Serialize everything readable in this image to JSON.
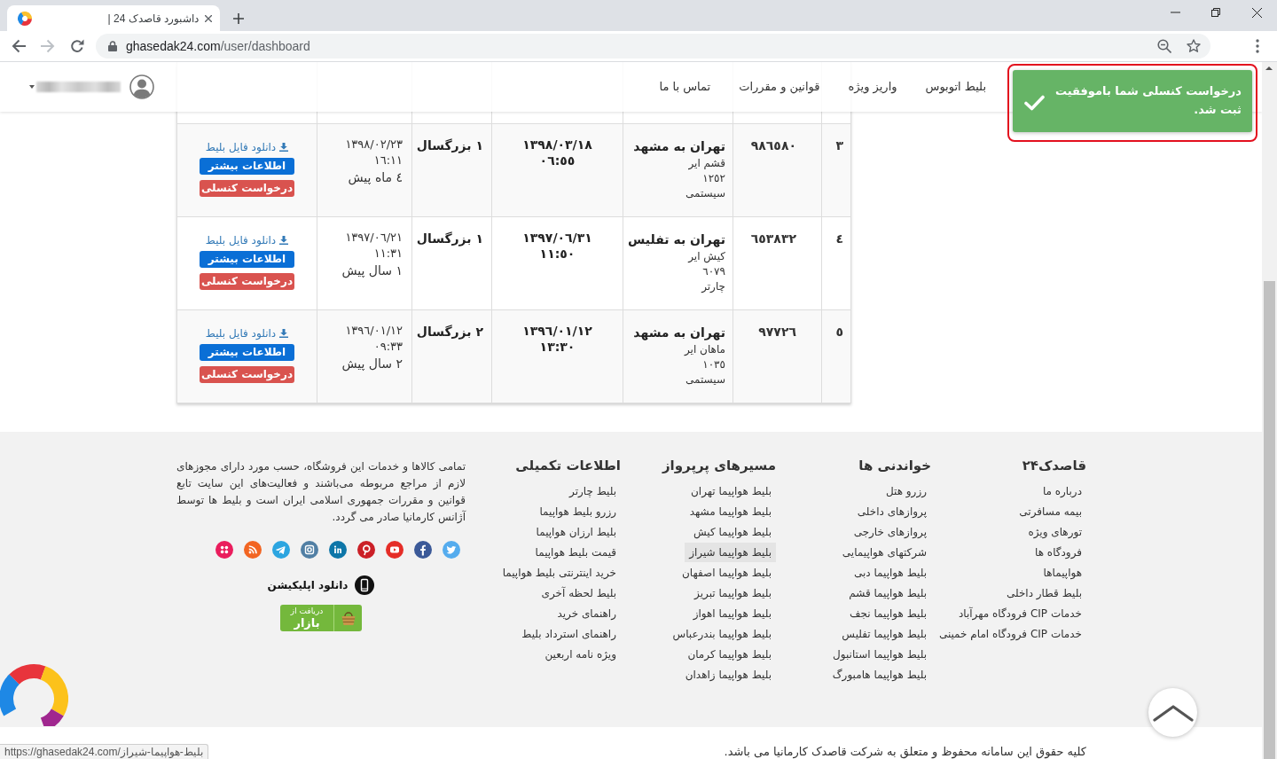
{
  "browser": {
    "tab": {
      "title": "داشبورد قاصدک 24 |"
    },
    "address": {
      "host": "ghasedak24.com",
      "path": "/user/dashboard"
    },
    "status_url": "https://ghasedak24.com/بلیط-هواپیما-شیراز"
  },
  "header": {
    "nav": [
      "بلیط اتوبوس",
      "واریز ویژه",
      "قوانین و مقررات",
      "تماس با ما"
    ]
  },
  "toast": {
    "message": "درخواست کنسلی شما باموفقیت ثبت شد.",
    "annotated": true
  },
  "table": {
    "rows": [
      {
        "kind": "clipped"
      },
      {
        "kind": "full",
        "number": "٣",
        "code": "٩٨٦٥٨٠",
        "route": {
          "title": "تهران به مشهد",
          "airline": "قشم ایر",
          "flight": "١٢٥٢",
          "type": "سیستمی"
        },
        "flight_date": {
          "date": "١٣٩٨/٠٣/١٨",
          "time": "٠٦:٥٥"
        },
        "passengers": "١ بزرگسال",
        "purchase": {
          "date": "١٣٩٨/٠٢/٢٣",
          "time": "١٦:١١",
          "ago": "٤ ماه پیش"
        },
        "actions": {
          "download": "دانلود فایل بلیط",
          "info": "اطلاعات بیشتر",
          "cancel": "درخواست کنسلی"
        }
      },
      {
        "kind": "full",
        "number": "٤",
        "code": "٦٥٣٨٣٢",
        "route": {
          "title": "تهران به تفلیس",
          "airline": "کیش ایر",
          "flight": "٦٠٧٩",
          "type": "چارتر"
        },
        "flight_date": {
          "date": "١٣٩٧/٠٦/٣١",
          "time": "١١:٥٠"
        },
        "passengers": "١ بزرگسال",
        "purchase": {
          "date": "١٣٩٧/٠٦/٢١",
          "time": "١١:٣١",
          "ago": "١ سال پیش"
        },
        "actions": {
          "download": "دانلود فایل بلیط",
          "info": "اطلاعات بیشتر",
          "cancel": "درخواست کنسلی"
        }
      },
      {
        "kind": "full",
        "number": "٥",
        "code": "٩٧٧٢٦",
        "route": {
          "title": "تهران به مشهد",
          "airline": "ماهان ایر",
          "flight": "١٠٣٥",
          "type": "سیستمی"
        },
        "flight_date": {
          "date": "١٣٩٦/٠١/١٢",
          "time": "١٣:٣٠"
        },
        "passengers": "٢ بزرگسال",
        "purchase": {
          "date": "١٣٩٦/٠١/١٢",
          "time": "٠٩:٣٣",
          "ago": "٢ سال پیش"
        },
        "actions": {
          "download": "دانلود فایل بلیط",
          "info": "اطلاعات بیشتر",
          "cancel": "درخواست کنسلی"
        }
      }
    ]
  },
  "footer": {
    "columns": [
      {
        "title": "قاصدک۲۴",
        "links": [
          {
            "label": "درباره ما",
            "highlighted": false
          },
          {
            "label": "بیمه مسافرتی",
            "highlighted": false
          },
          {
            "label": "تورهای ویژه",
            "highlighted": false
          },
          {
            "label": "فرودگاه ها",
            "highlighted": false
          },
          {
            "label": "هواپیماها",
            "highlighted": false
          },
          {
            "label": "بلیط قطار داخلی",
            "highlighted": false
          },
          {
            "label": "خدمات CIP فرودگاه مهرآباد",
            "highlighted": false
          },
          {
            "label": "خدمات CIP فرودگاه امام خمینی",
            "highlighted": false
          }
        ]
      },
      {
        "title": "خواندنی ها",
        "links": [
          {
            "label": "رزرو هتل",
            "highlighted": false
          },
          {
            "label": "پروازهای داخلی",
            "highlighted": false
          },
          {
            "label": "پروازهای خارجی",
            "highlighted": false
          },
          {
            "label": "شرکتهای هواپیمایی",
            "highlighted": false
          },
          {
            "label": "بلیط هواپیما دبی",
            "highlighted": false
          },
          {
            "label": "بلیط هواپیما قشم",
            "highlighted": false
          },
          {
            "label": "بلیط هواپیما نجف",
            "highlighted": false
          },
          {
            "label": "بلیط هواپیما تفلیس",
            "highlighted": false
          },
          {
            "label": "بلیط هواپیما استانبول",
            "highlighted": false
          },
          {
            "label": "بلیط هواپیما هامبورگ",
            "highlighted": false
          }
        ]
      },
      {
        "title": "مسیرهای پرپرواز",
        "links": [
          {
            "label": "بلیط هواپیما تهران",
            "highlighted": false
          },
          {
            "label": "بلیط هواپیما مشهد",
            "highlighted": false
          },
          {
            "label": "بلیط هواپیما کیش",
            "highlighted": false
          },
          {
            "label": "بلیط هواپیما شیراز",
            "highlighted": true
          },
          {
            "label": "بلیط هواپیما اصفهان",
            "highlighted": false
          },
          {
            "label": "بلیط هواپیما تبریز",
            "highlighted": false
          },
          {
            "label": "بلیط هواپیما اهواز",
            "highlighted": false
          },
          {
            "label": "بلیط هواپیما بندرعباس",
            "highlighted": false
          },
          {
            "label": "بلیط هواپیما کرمان",
            "highlighted": false
          },
          {
            "label": "بلیط هواپیما زاهدان",
            "highlighted": false
          }
        ]
      },
      {
        "title": "اطلاعات تکمیلی",
        "links": [
          {
            "label": "بلیط چارتر",
            "highlighted": false
          },
          {
            "label": "رزرو بلیط هواپیما",
            "highlighted": false
          },
          {
            "label": "بلیط ارزان هواپیما",
            "highlighted": false
          },
          {
            "label": "قیمت بلیط هواپیما",
            "highlighted": false
          },
          {
            "label": "خرید اینترنتی بلیط هواپیما",
            "highlighted": false
          },
          {
            "label": "بلیط لحظه آخری",
            "highlighted": false
          },
          {
            "label": "راهنمای خرید",
            "highlighted": false
          },
          {
            "label": "راهنمای استرداد بلیط",
            "highlighted": false
          },
          {
            "label": "ویژه نامه اربعین",
            "highlighted": false
          }
        ]
      }
    ],
    "about": "تمامی کالاها و خدمات این فروشگاه، حسب مورد دارای مجوزهای لازم از مراجع مربوطه می‌باشند و فعالیت‌های این سایت تابع قوانین و مقررات جمهوری اسلامی ایران است و بلیط ها توسط آژانس کارمانیا صادر می گردد.",
    "app": {
      "label": "دانلود اپلیکیشن",
      "badge": {
        "caption": "دریافت از",
        "store": "بازار"
      }
    },
    "copyright": "کلیه حقوق این سامانه محفوظ و متعلق به شرکت قاصدک کارمانیا می باشد."
  }
}
